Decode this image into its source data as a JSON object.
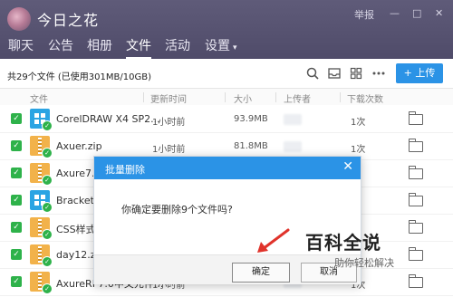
{
  "window": {
    "group_name": "今日之花",
    "report_label": "举报",
    "minimize_glyph": "—",
    "maximize_glyph": "□",
    "close_glyph": "✕"
  },
  "tabs": [
    {
      "label": "聊天"
    },
    {
      "label": "公告"
    },
    {
      "label": "相册"
    },
    {
      "label": "文件",
      "active": true
    },
    {
      "label": "活动"
    },
    {
      "label": "设置",
      "caret": "▾"
    }
  ],
  "toolbar": {
    "summary": "共29个文件 (已使用301MB/10GB)",
    "upload_label": "+ 上传",
    "icons": [
      "search-icon",
      "inbox-icon",
      "grid-icon",
      "more-icon"
    ]
  },
  "table": {
    "headers": {
      "file": "文件",
      "time": "更新时间",
      "size": "大小",
      "uploader": "上传者",
      "downloads": "下载次数"
    },
    "rows": [
      {
        "name": "CorelDRAW X4 SP2...",
        "icon": "exe",
        "time": "1小时前",
        "size": "93.9MB",
        "downloads": "1次"
      },
      {
        "name": "Axuer.zip",
        "icon": "zip",
        "time": "1小时前",
        "size": "81.8MB",
        "downloads": "1次"
      },
      {
        "name": "Axure7.0",
        "icon": "zip",
        "time": "",
        "size": "",
        "downloads": ""
      },
      {
        "name": "Brackets.",
        "icon": "exe",
        "time": "",
        "size": "",
        "downloads": ""
      },
      {
        "name": "CSS样式",
        "icon": "zip",
        "time": "",
        "size": "",
        "downloads": ""
      },
      {
        "name": "day12.zip",
        "icon": "zip",
        "time": "",
        "size": "",
        "downloads": ""
      },
      {
        "name": "AxureRP7.0中文元件...",
        "icon": "zip",
        "time": "1小时前",
        "size": "474KB",
        "downloads": "1次"
      }
    ]
  },
  "dialog": {
    "title": "批量删除",
    "close_glyph": "✕",
    "message": "你确定要删除9个文件吗?",
    "ok_label": "确定",
    "cancel_label": "取消"
  },
  "watermark": {
    "main": "百科全说",
    "sub": "助你轻松解决"
  },
  "colors": {
    "header_bg": "#57536f",
    "accent_blue": "#2b93e6",
    "check_green": "#2eb24a",
    "annotation_red": "#e0332b"
  }
}
